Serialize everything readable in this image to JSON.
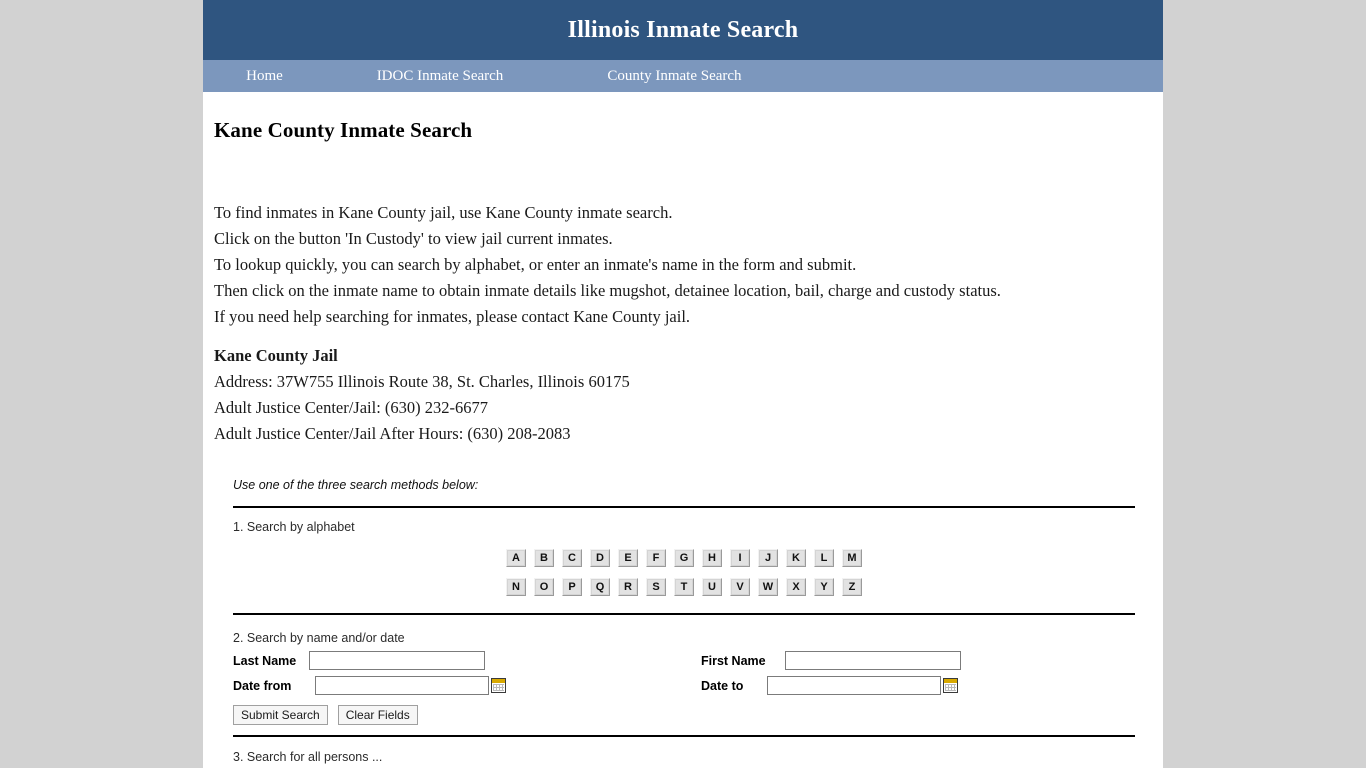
{
  "theme": {
    "page_background": "#d2d2d2",
    "content_background": "#ffffff",
    "header_blue": "#2f5580",
    "nav_blue": "#7c97bd",
    "header_text": "#ffffff",
    "rule_color": "#000000",
    "button_face": "#e2e2e2",
    "calendar_accent": "#d8a900"
  },
  "header": {
    "title": "Illinois Inmate Search"
  },
  "nav": {
    "items": [
      {
        "label": "Home"
      },
      {
        "label": "IDOC Inmate Search"
      },
      {
        "label": "County Inmate Search"
      }
    ]
  },
  "main": {
    "page_title": "Kane County Inmate Search",
    "intro_lines": [
      "To find inmates in Kane County jail, use Kane County inmate search.",
      "Click on the button 'In Custody' to view jail current inmates.",
      "To lookup quickly, you can search by alphabet, or enter an inmate's name in the form and submit.",
      "Then click on the inmate name to obtain inmate details like mugshot, detainee location, bail, charge and custody status.",
      "If you need help searching for inmates, please contact Kane County jail."
    ],
    "jail": {
      "name": "Kane County Jail",
      "address": "Address: 37W755 Illinois Route 38, St. Charles, Illinois 60175",
      "phone": "Adult Justice Center/Jail: (630) 232-6677",
      "after_hours": "Adult Justice Center/Jail After Hours: (630) 208-2083"
    }
  },
  "search": {
    "methods_note": "Use one of the three search methods below:",
    "method1_label": "1. Search by alphabet",
    "alphabet_row1": [
      "A",
      "B",
      "C",
      "D",
      "E",
      "F",
      "G",
      "H",
      "I",
      "J",
      "K",
      "L",
      "M"
    ],
    "alphabet_row2": [
      "N",
      "O",
      "P",
      "Q",
      "R",
      "S",
      "T",
      "U",
      "V",
      "W",
      "X",
      "Y",
      "Z"
    ],
    "method2_label": "2. Search by name and/or date",
    "fields": {
      "last_name_label": "Last Name",
      "last_name_value": "",
      "last_name_placeholder": "",
      "first_name_label": "First Name",
      "first_name_value": "",
      "first_name_placeholder": "",
      "date_from_label": "Date from",
      "date_from_value": "",
      "date_from_placeholder": "",
      "date_to_label": "Date to",
      "date_to_value": "",
      "date_to_placeholder": ""
    },
    "buttons": {
      "submit_label": "Submit Search",
      "clear_label": "Clear Fields"
    },
    "method3_label": "3. Search for all persons ..."
  }
}
